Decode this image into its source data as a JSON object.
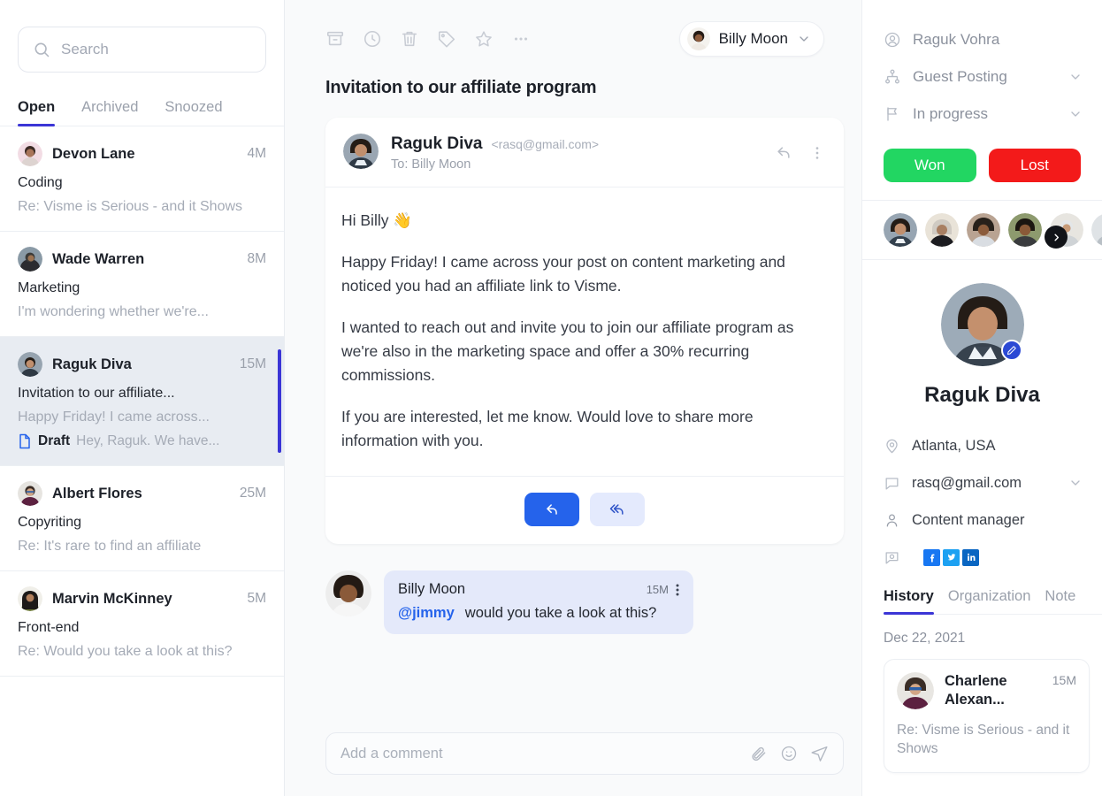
{
  "left": {
    "search": {
      "placeholder": "Search",
      "value": ""
    },
    "tabs": [
      {
        "label": "Open",
        "active": true
      },
      {
        "label": "Archived",
        "active": false
      },
      {
        "label": "Snoozed",
        "active": false
      }
    ],
    "threads": [
      {
        "name": "Devon Lane",
        "time": "4M",
        "subject": "Coding",
        "preview": "Re: Visme is Serious - and it Shows",
        "draft_label": "",
        "draft_text": "",
        "selected": false
      },
      {
        "name": "Wade Warren",
        "time": "8M",
        "subject": "Marketing",
        "preview": "I'm wondering whether we're...",
        "draft_label": "",
        "draft_text": "",
        "selected": false
      },
      {
        "name": "Raguk Diva",
        "time": "15M",
        "subject": "Invitation to our affiliate...",
        "preview": "Happy Friday! I came across...",
        "draft_label": "Draft",
        "draft_text": "Hey, Raguk. We have...",
        "selected": true
      },
      {
        "name": "Albert Flores",
        "time": "25M",
        "subject": "Copyriting",
        "preview": "Re: It's rare to find an affiliate",
        "draft_label": "",
        "draft_text": "",
        "selected": false
      },
      {
        "name": "Marvin McKinney",
        "time": "5M",
        "subject": "Front-end",
        "preview": "Re: Would you take a look at this?",
        "draft_label": "",
        "draft_text": "",
        "selected": false
      }
    ]
  },
  "center": {
    "toolbar_icons": [
      "archive-icon",
      "clock-icon",
      "trash-icon",
      "tag-icon",
      "star-icon",
      "more-icon"
    ],
    "user_chip": {
      "name": "Billy Moon"
    },
    "mail_title": "Invitation to our affiliate program",
    "mail_header": {
      "sender": "Raguk Diva",
      "email": "<rasq@gmail.com>",
      "to": "To: Billy Moon"
    },
    "body_paragraphs": [
      "Hi Billy 👋",
      "Happy Friday! I came across your post on content marketing and noticed you had an affiliate link to Visme.",
      "I wanted to reach out and invite you to join our affiliate program as we're also in the marketing space and offer a 30% recurring commissions.",
      "If you are interested, let me know. Would love to share more information with you."
    ],
    "reply_buttons": {
      "reply": "reply-icon",
      "reply_all": "reply-all-icon"
    },
    "comment": {
      "author": "Billy Moon",
      "time": "15M",
      "mention": "@jimmy",
      "text": "would you take a look at this?"
    },
    "compose": {
      "placeholder": "Add a comment",
      "value": ""
    }
  },
  "right": {
    "meta_rows": [
      {
        "icon": "user-circle-icon",
        "label": "Raguk Vohra",
        "chevron": false
      },
      {
        "icon": "hierarchy-icon",
        "label": "Guest Posting",
        "chevron": true
      },
      {
        "icon": "flag-icon",
        "label": "In progress",
        "chevron": true
      }
    ],
    "status_buttons": {
      "won": "Won",
      "lost": "Lost"
    },
    "colors": {
      "won": "#22d662",
      "lost": "#f31a1a",
      "accent": "#3b35d6",
      "reply": "#2563eb"
    },
    "participants_count": 6,
    "profile": {
      "name": "Raguk Diva",
      "details": [
        {
          "icon": "location-icon",
          "label": "Atlanta, USA",
          "chevron": false
        },
        {
          "icon": "chat-icon",
          "label": "rasq@gmail.com",
          "chevron": true
        },
        {
          "icon": "person-icon",
          "label": "Content manager",
          "chevron": false
        }
      ],
      "socials": [
        "facebook-icon",
        "twitter-icon",
        "linkedin-icon"
      ]
    },
    "tabs": [
      {
        "label": "History",
        "active": true
      },
      {
        "label": "Organization",
        "active": false
      },
      {
        "label": "Note",
        "active": false
      }
    ],
    "history_date": "Dec 22, 2021",
    "history_cards": [
      {
        "name": "Charlene Alexan...",
        "time": "15M",
        "subject": "Re: Visme is Serious - and it Shows"
      }
    ]
  }
}
